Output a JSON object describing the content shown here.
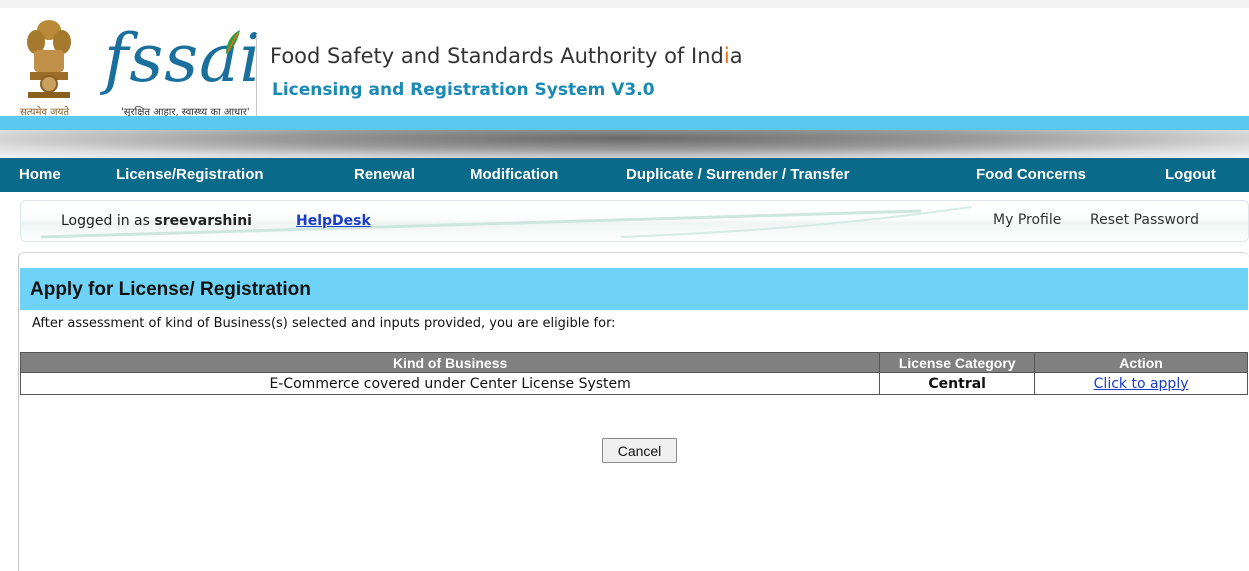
{
  "header": {
    "emblem_caption": "सत्यमेव जयते",
    "logo_text": "fssai",
    "logo_tagline": "'सुरक्षित आहार, स्वास्थ्य का आधार'",
    "org_title_main": "Food Safety and Standards Authority of Ind",
    "org_title_accent": "i",
    "org_title_end": "a",
    "system_title": "Licensing and Registration System V3.0"
  },
  "nav": {
    "items": [
      "Home",
      "License/Registration",
      "Renewal",
      "Modification",
      "Duplicate / Surrender / Transfer",
      "Food Concerns",
      "Logout"
    ]
  },
  "userbar": {
    "logged_prefix": "Logged in as",
    "username": "sreevarshini",
    "helpdesk": "HelpDesk",
    "my_profile": "My Profile",
    "reset_password": "Reset Password"
  },
  "main": {
    "title": "Apply for License/ Registration",
    "eligibility_text": "After assessment of kind of Business(s) selected and inputs provided, you are eligible for:",
    "table": {
      "headers": [
        "Kind of Business",
        "License Category",
        "Action"
      ],
      "rows": [
        {
          "business": "E-Commerce covered under Center License System",
          "category": "Central",
          "action": "Click to apply"
        }
      ]
    },
    "cancel_label": "Cancel"
  },
  "colors": {
    "nav_bg": "#0a6a8a",
    "panel_header_bg": "#6fd3f7",
    "accent_band": "#5ac8f0",
    "link": "#1a3cc8"
  }
}
